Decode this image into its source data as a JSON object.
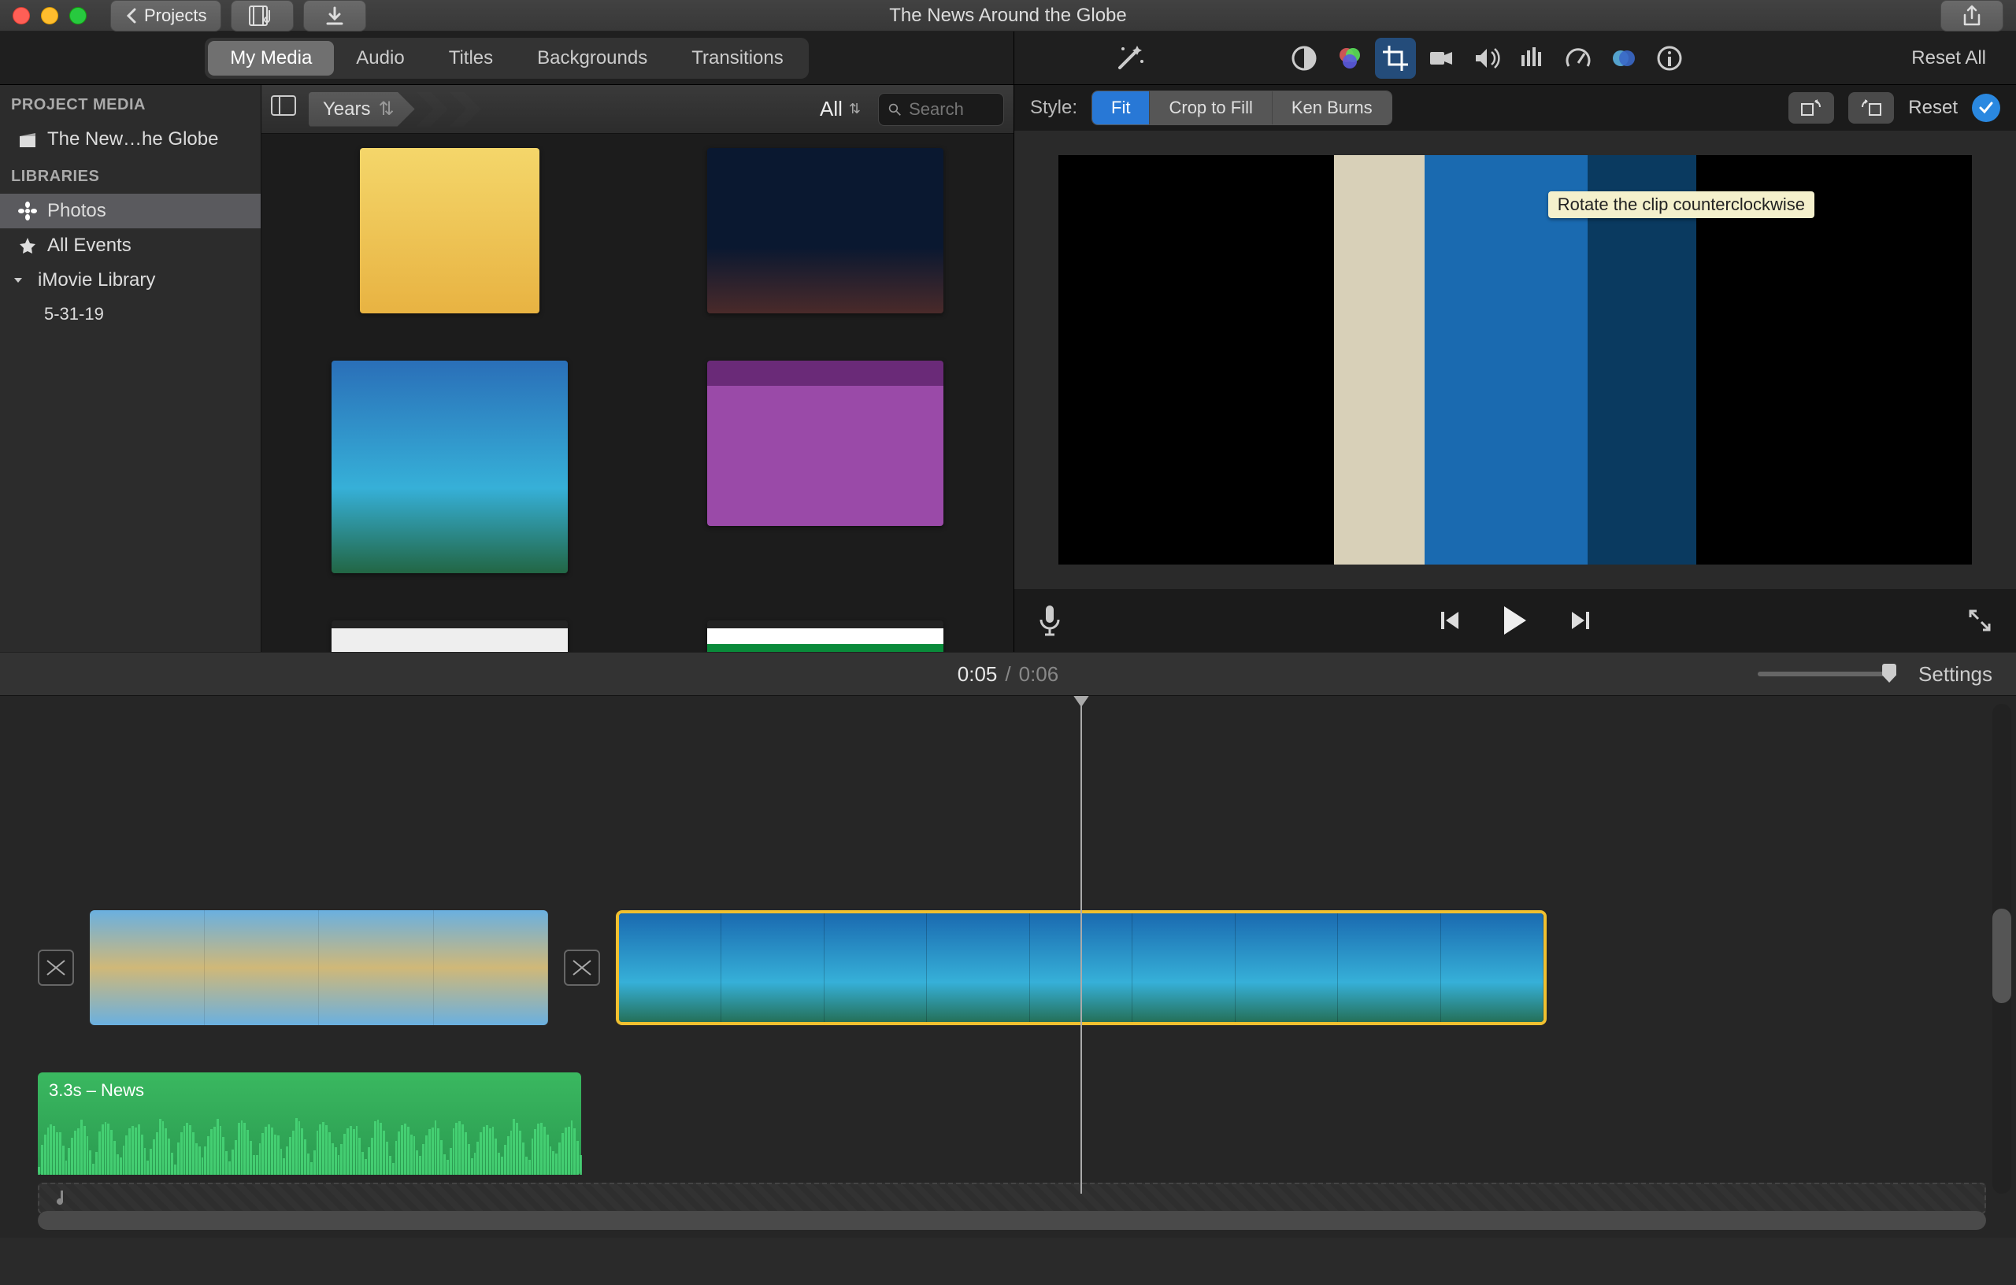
{
  "window": {
    "title": "The News Around the Globe"
  },
  "titlebar": {
    "projects_label": "Projects"
  },
  "tabs": {
    "items": [
      "My Media",
      "Audio",
      "Titles",
      "Backgrounds",
      "Transitions"
    ],
    "active_index": 0
  },
  "toolbar_right": {
    "reset_all": "Reset All",
    "icons": [
      "auto-enhance-icon",
      "color-balance-icon",
      "color-correction-icon",
      "crop-icon",
      "stabilize-icon",
      "volume-icon",
      "noise-icon",
      "speed-icon",
      "filters-icon",
      "info-icon"
    ],
    "active_icon_index": 3
  },
  "sidebar": {
    "project_media_header": "PROJECT MEDIA",
    "project_name": "The New…he Globe",
    "libraries_header": "LIBRARIES",
    "photos": "Photos",
    "all_events": "All Events",
    "imovie_library": "iMovie Library",
    "event_date": "5-31-19",
    "active": "photos"
  },
  "browser_toolbar": {
    "crumb1": "Years",
    "filter": "All",
    "search_placeholder": "Search"
  },
  "style_row": {
    "label": "Style:",
    "options": [
      "Fit",
      "Crop to Fill",
      "Ken Burns"
    ],
    "active_index": 0,
    "reset": "Reset",
    "tooltip": "Rotate the clip counterclockwise"
  },
  "time": {
    "current": "0:05",
    "sep": "/",
    "duration": "0:06"
  },
  "settings_label": "Settings",
  "audio": {
    "clip_label": "3.3s – News"
  }
}
